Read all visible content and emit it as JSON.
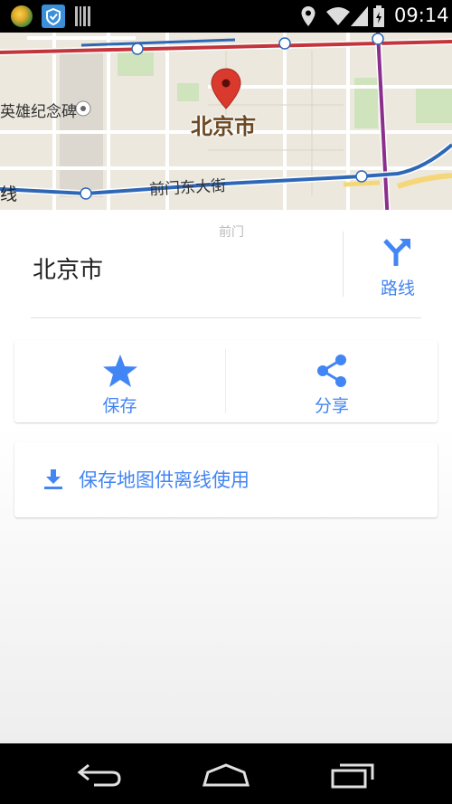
{
  "status_bar": {
    "time": "09:14",
    "left_icons": [
      "google-maps-app-icon",
      "shield-app-icon",
      "barcode-icon"
    ],
    "right_icons": [
      "location-pin-icon",
      "wifi-icon",
      "signal-icon",
      "battery-icon"
    ]
  },
  "map": {
    "pin_label": "北京市",
    "poi_label": "英雄纪念碑",
    "street_label": "前门东大街",
    "line_label_left": "线",
    "area_label": "前门",
    "colors": {
      "road_red": "#c1353b",
      "road_blue": "#2e67b6",
      "road_purple": "#8b2f8c",
      "pin": "#da3a2e"
    }
  },
  "place": {
    "name": "北京市",
    "directions_label": "路线"
  },
  "actions": {
    "save_label": "保存",
    "share_label": "分享"
  },
  "offline": {
    "label": "保存地图供离线使用"
  },
  "accent_color": "#4285f4",
  "nav_bar": {
    "icons": [
      "back-icon",
      "home-icon",
      "recent-apps-icon"
    ]
  }
}
